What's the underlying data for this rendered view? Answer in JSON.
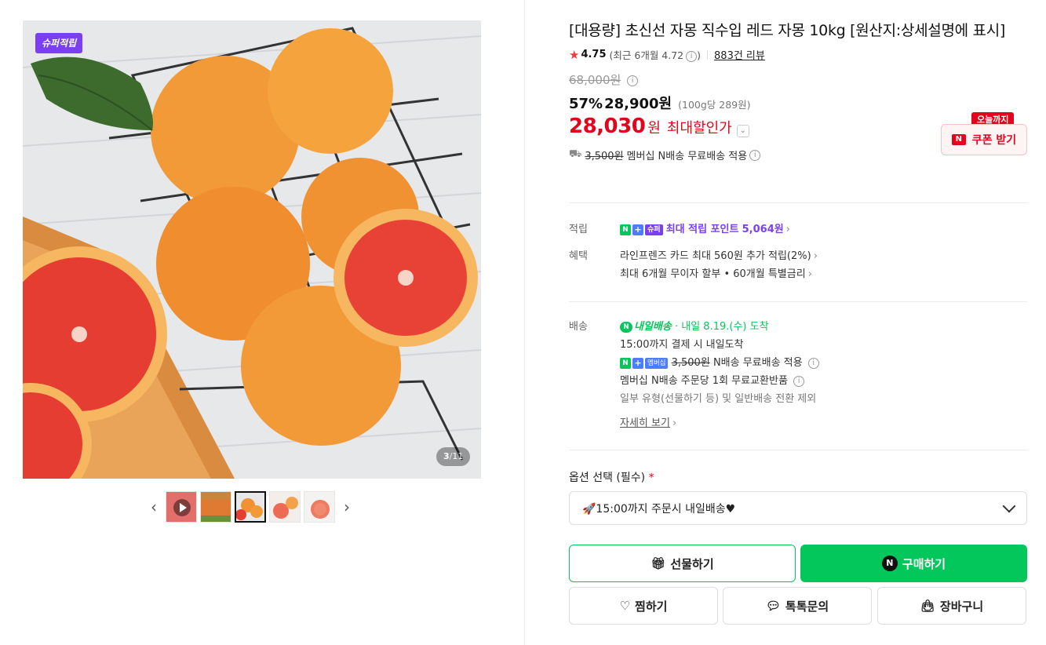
{
  "gallery": {
    "super_badge": "슈퍼적립",
    "page_current": "3",
    "page_sep": "/",
    "page_total": "11"
  },
  "product": {
    "title": "[대용량] 초신선 자몽 직수입 레드 자몽 10kg [원산지:상세설명에 표시]",
    "rating": "4.75",
    "recent_rating": "(최근 6개월 4.72",
    "recent_rating_close": ")",
    "reviews": "883건 리뷰",
    "original_price": "68,000원",
    "discount_pct": "57%",
    "sale_price": "28,900원",
    "unit_price": "(100g당 289원)",
    "max_price": "28,030",
    "max_won": "원",
    "max_label": "최대할인가",
    "ship_orig": "3,500원",
    "ship_text": "멤버십 N배송 무료배송 적용"
  },
  "coupon": {
    "tag": "오늘까지",
    "icon": "N",
    "label": "쿠폰 받기"
  },
  "points": {
    "label": "적립",
    "badge_n": "N",
    "badge_plus": "+",
    "badge_super": "슈퍼",
    "text": "최대 적립 포인트",
    "amount": "5,064원"
  },
  "benefits": {
    "label": "혜택",
    "line1": "라인프렌즈 카드 최대 560원 추가 적립(2%)",
    "line2": "최대 6개월 무이자 할부 • 60개월 특별금리"
  },
  "delivery": {
    "label": "배송",
    "badge": "내일배송",
    "badge_n": "N",
    "arrival": "· 내일 8.19.(수) 도착",
    "line1": "15:00까지 결제 시 내일도착",
    "member_badge": "멤버십",
    "ship_orig": "3,500원",
    "ship_text": "N배송 무료배송 적용",
    "line3": "멤버십 N배송 주문당 1회 무료교환반품",
    "line4": "일부 유형(선물하기 등) 및 일반배송 전환 제외",
    "detail_link": "자세히 보기"
  },
  "option": {
    "label": "옵션 선택 (필수)",
    "required_mark": "*",
    "selected": "🚀15:00까지 주문시 내일배송♥"
  },
  "buttons": {
    "gift": "선물하기",
    "buy_icon": "N",
    "buy": "구매하기",
    "wish": "찜하기",
    "talk": "톡톡문의",
    "cart": "장바구니"
  },
  "icons": {
    "star": "star-icon",
    "info": "info-icon",
    "truck": "truck-icon",
    "gift": "gift-icon",
    "heart": "heart-icon",
    "chat": "chat-icon",
    "bag": "shopping-bag-icon"
  },
  "colors": {
    "brand_green": "#03c75a",
    "sale_red": "#e2061c",
    "super_purple": "#7b3ff2"
  }
}
